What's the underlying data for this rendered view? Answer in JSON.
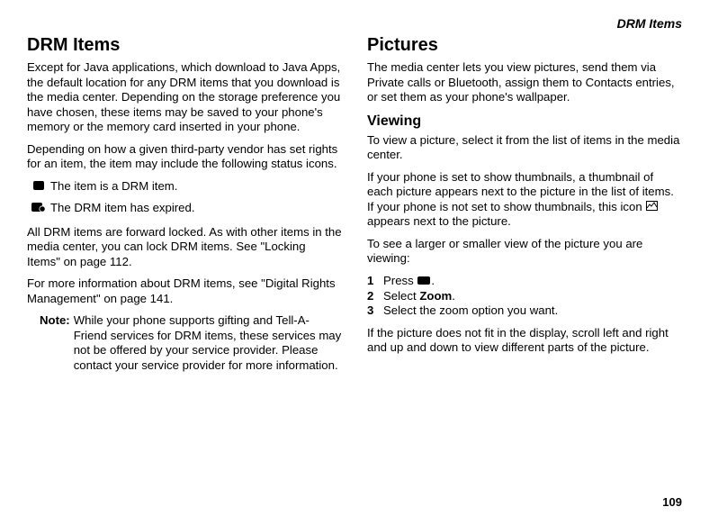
{
  "header": "DRM Items",
  "pageNumber": "109",
  "left": {
    "h1": "DRM Items",
    "p1": "Except for Java applications, which download to Java Apps, the default location for any DRM items that you download is the media center. Depending on the storage preference you have chosen, these items may be saved to your phone's memory or the memory card inserted in your phone.",
    "p2": "Depending on how a given third-party vendor has set rights for an item, the item may include the following status icons.",
    "iconList": [
      {
        "icon": "drm-item-icon",
        "text": "The item is a DRM item."
      },
      {
        "icon": "drm-expired-icon",
        "text": "The DRM item has expired."
      }
    ],
    "p3": "All DRM items are forward locked. As with other items in the media center, you can lock DRM items. See \"Locking Items\" on page 112.",
    "p4": "For more information about DRM items, see \"Digital Rights Management\" on page 141.",
    "noteLabel": "Note:",
    "noteBody": "While your phone supports gifting and Tell-A-Friend services for DRM items, these services may not be offered by your service provider. Please contact your service provider for more information."
  },
  "right": {
    "h1": "Pictures",
    "p1": "The media center lets you view pictures, send them via Private calls or Bluetooth, assign them to Contacts entries, or set them as your phone's wallpaper.",
    "h2": "Viewing",
    "p2": "To view a picture, select it from the list of items in the media center.",
    "p3a": "If your phone is set to show thumbnails, a thumbnail of each picture appears next to the picture in the list of items. If your phone is not set to show thumbnails, this icon ",
    "p3b": " appears next to the picture.",
    "p4": "To see a larger or smaller view of the picture you are viewing:",
    "steps": [
      {
        "num": "1",
        "pre": "Press ",
        "iconName": "menu-key-icon",
        "post": "."
      },
      {
        "num": "2",
        "pre": "Select ",
        "bold": "Zoom",
        "post": "."
      },
      {
        "num": "3",
        "pre": "Select the zoom option you want.",
        "post": ""
      }
    ],
    "p5": "If the picture does not fit in the display, scroll left and right and up and down to view different parts of the picture."
  }
}
